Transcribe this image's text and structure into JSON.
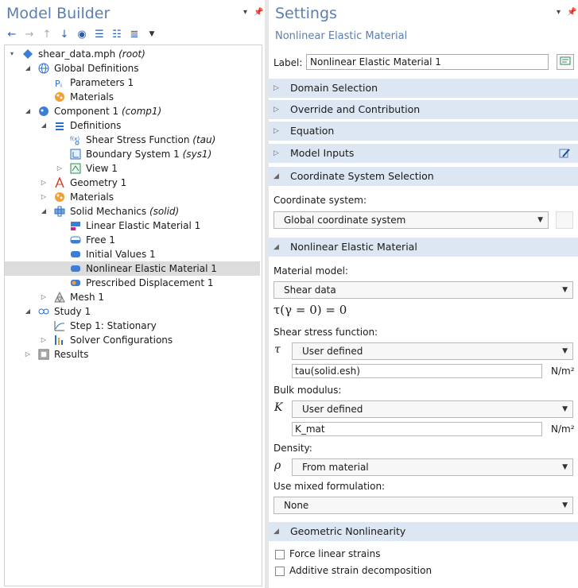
{
  "left": {
    "title": "Model Builder",
    "tree": [
      {
        "label": "shear_data.mph",
        "tag": "(root)",
        "level": 0,
        "tw": "▾",
        "icon": "root-icon"
      },
      {
        "label": "Global Definitions",
        "tag": "",
        "level": 1,
        "tw": "◢",
        "icon": "globe-icon"
      },
      {
        "label": "Parameters 1",
        "tag": "",
        "level": 2,
        "tw": "",
        "icon": "parameters-icon"
      },
      {
        "label": "Materials",
        "tag": "",
        "level": 2,
        "tw": "",
        "icon": "materials-icon"
      },
      {
        "label": "Component 1",
        "tag": "(comp1)",
        "level": 1,
        "tw": "◢",
        "icon": "component-icon"
      },
      {
        "label": "Definitions",
        "tag": "",
        "level": 2,
        "tw": "◢",
        "icon": "definitions-icon"
      },
      {
        "label": "Shear Stress Function",
        "tag": "(tau)",
        "level": 3,
        "tw": "",
        "icon": "function-icon"
      },
      {
        "label": "Boundary System 1",
        "tag": "(sys1)",
        "level": 3,
        "tw": "",
        "icon": "coordinate-system-icon"
      },
      {
        "label": "View 1",
        "tag": "",
        "level": 3,
        "tw": "▷",
        "icon": "view-icon"
      },
      {
        "label": "Geometry 1",
        "tag": "",
        "level": 2,
        "tw": "▷",
        "icon": "geometry-icon"
      },
      {
        "label": "Materials",
        "tag": "",
        "level": 2,
        "tw": "▷",
        "icon": "materials-icon"
      },
      {
        "label": "Solid Mechanics",
        "tag": "(solid)",
        "level": 2,
        "tw": "◢",
        "icon": "solid-mechanics-icon"
      },
      {
        "label": "Linear Elastic Material 1",
        "tag": "",
        "level": 3,
        "tw": "",
        "icon": "linear-elastic-icon"
      },
      {
        "label": "Free 1",
        "tag": "",
        "level": 3,
        "tw": "",
        "icon": "free-icon"
      },
      {
        "label": "Initial Values 1",
        "tag": "",
        "level": 3,
        "tw": "",
        "icon": "initial-values-icon"
      },
      {
        "label": "Nonlinear Elastic Material 1",
        "tag": "",
        "level": 3,
        "tw": "",
        "icon": "nonlinear-elastic-icon",
        "selected": true
      },
      {
        "label": "Prescribed Displacement 1",
        "tag": "",
        "level": 3,
        "tw": "",
        "icon": "prescribed-displacement-icon"
      },
      {
        "label": "Mesh 1",
        "tag": "",
        "level": 2,
        "tw": "▷",
        "icon": "mesh-icon"
      },
      {
        "label": "Study 1",
        "tag": "",
        "level": 1,
        "tw": "◢",
        "icon": "study-icon"
      },
      {
        "label": "Step 1: Stationary",
        "tag": "",
        "level": 2,
        "tw": "",
        "icon": "stationary-step-icon"
      },
      {
        "label": "Solver Configurations",
        "tag": "",
        "level": 2,
        "tw": "▷",
        "icon": "solver-icon"
      },
      {
        "label": "Results",
        "tag": "",
        "level": 1,
        "tw": "▷",
        "icon": "results-icon"
      }
    ]
  },
  "right": {
    "title": "Settings",
    "subtitle": "Nonlinear Elastic Material",
    "label_caption": "Label:",
    "label_value": "Nonlinear Elastic Material 1",
    "sections": {
      "domain": "Domain Selection",
      "override": "Override and Contribution",
      "equation": "Equation",
      "inputs": "Model Inputs",
      "coord": "Coordinate System Selection",
      "nonlinear": "Nonlinear Elastic Material",
      "geom": "Geometric Nonlinearity"
    },
    "coord_label": "Coordinate system:",
    "coord_value": "Global coordinate system",
    "material_model_label": "Material model:",
    "material_model_value": "Shear data",
    "equation_text": "τ(γ = 0) = 0",
    "shear_label": "Shear stress function:",
    "shear_symbol": "τ",
    "shear_value": "User defined",
    "shear_expr": "tau(solid.esh)",
    "shear_unit": "N/m²",
    "bulk_label": "Bulk modulus:",
    "bulk_symbol": "K",
    "bulk_value": "User defined",
    "bulk_expr": "K_mat",
    "bulk_unit": "N/m²",
    "density_label": "Density:",
    "density_symbol": "ρ",
    "density_value": "From material",
    "mixed_label": "Use mixed formulation:",
    "mixed_value": "None",
    "chk1": "Force linear strains",
    "chk2": "Additive strain decomposition"
  }
}
